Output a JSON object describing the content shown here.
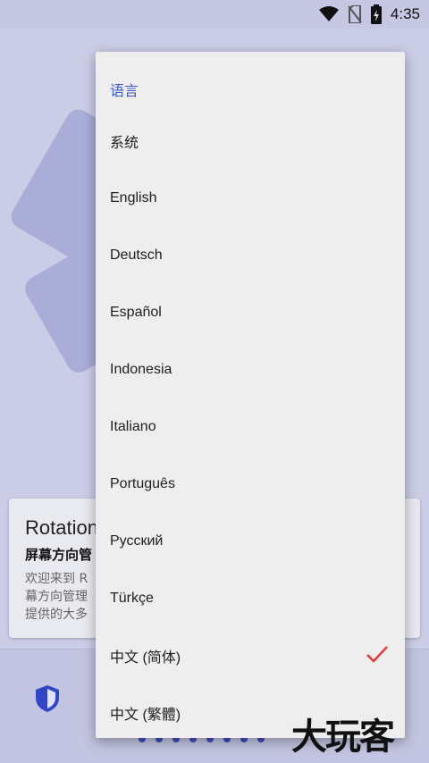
{
  "status_bar": {
    "time": "4:35",
    "icons": [
      "wifi-icon",
      "no-sim-icon",
      "battery-charging-icon"
    ]
  },
  "background": {
    "card": {
      "title": "Rotation",
      "subtitle": "屏幕方向管",
      "body_lines": [
        "欢迎来到 R",
        "幕方向管理",
        "提供的大多"
      ]
    },
    "pager_dot_count": 8
  },
  "dropdown": {
    "header": "语言",
    "items": [
      {
        "label": "系统"
      },
      {
        "label": "English"
      },
      {
        "label": "Deutsch"
      },
      {
        "label": "Español"
      },
      {
        "label": "Indonesia"
      },
      {
        "label": "Italiano"
      },
      {
        "label": "Português"
      },
      {
        "label": "Русский"
      },
      {
        "label": "Türkçe"
      },
      {
        "label": "中文 (简体)",
        "selected": true
      },
      {
        "label": "中文 (繁體)"
      }
    ],
    "check_color": "#e53935",
    "header_color": "#3b57c9"
  },
  "watermark": "大玩客"
}
